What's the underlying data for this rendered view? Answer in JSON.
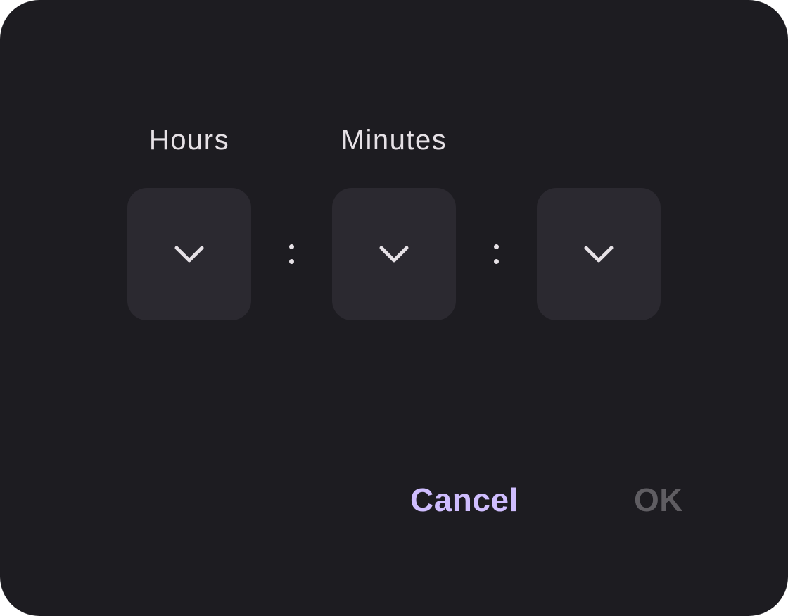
{
  "dialog": {
    "labels": {
      "hours": "Hours",
      "minutes": "Minutes"
    },
    "pickers": [
      {
        "name": "hours",
        "icon": "chevron-down-icon"
      },
      {
        "name": "minutes",
        "icon": "chevron-down-icon"
      },
      {
        "name": "seconds",
        "icon": "chevron-down-icon"
      }
    ],
    "actions": {
      "cancel_label": "Cancel",
      "ok_label": "OK"
    }
  },
  "colors": {
    "background": "#1d1c21",
    "picker_background": "#2b2930",
    "text": "#e6e1e6",
    "accent": "#cfbdfe",
    "disabled": "#5f5d62"
  }
}
